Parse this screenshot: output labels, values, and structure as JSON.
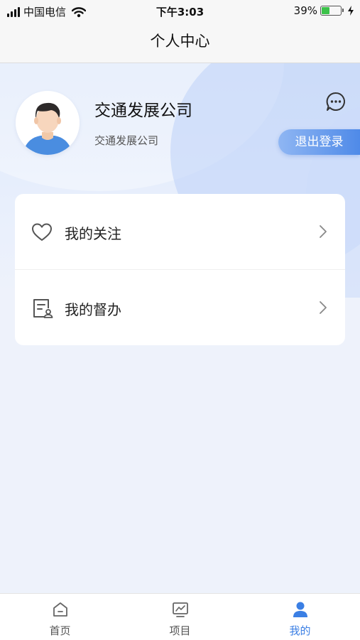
{
  "status_bar": {
    "carrier": "中国电信",
    "time": "下午3:03",
    "battery": "39%",
    "battery_level": 0.39
  },
  "nav": {
    "title": "个人中心"
  },
  "profile": {
    "name": "交通发展公司",
    "org": "交通发展公司",
    "logout_label": "退出登录"
  },
  "menu": {
    "items": [
      {
        "label": "我的关注",
        "icon": "heart-icon"
      },
      {
        "label": "我的督办",
        "icon": "supervise-doc-icon"
      }
    ]
  },
  "tabbar": {
    "items": [
      {
        "label": "首页",
        "icon": "home-icon"
      },
      {
        "label": "项目",
        "icon": "project-chart-icon"
      },
      {
        "label": "我的",
        "icon": "user-icon",
        "active": true
      }
    ]
  },
  "colors": {
    "accent": "#3b7fe4",
    "background": "#eef2fb"
  }
}
